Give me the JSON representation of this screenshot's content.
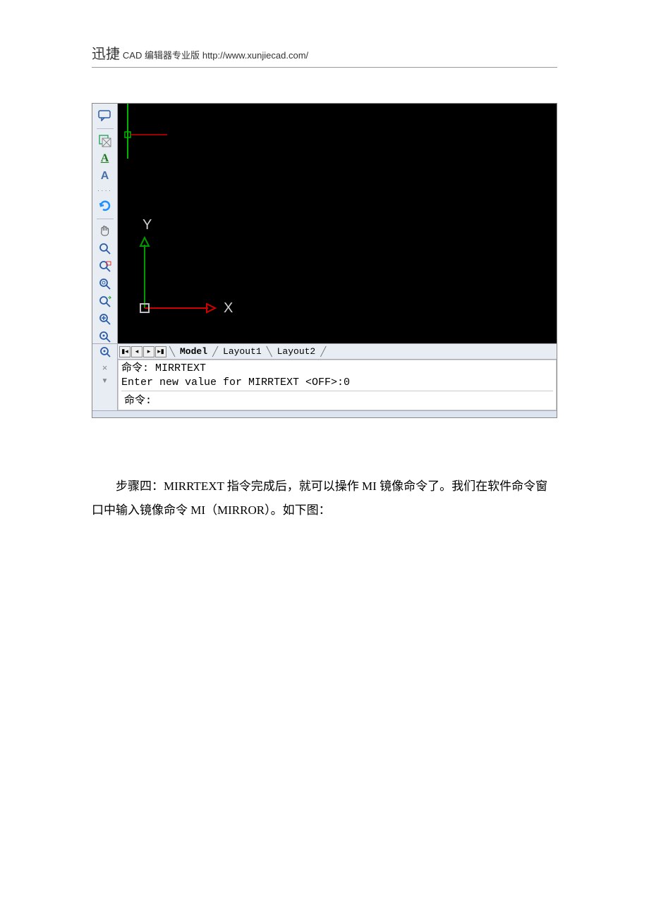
{
  "header": {
    "brand": "迅捷",
    "product": "CAD 编辑器专业版",
    "url": "http://www.xunjiecad.com/"
  },
  "toolbar": {
    "icons": [
      {
        "name": "word-balloon-icon",
        "glyph": "💬"
      },
      {
        "name": "overlap-rect-icon",
        "glyph": "▧"
      },
      {
        "name": "text-underline-a-icon",
        "glyph": "A",
        "underline": true,
        "color": "#1e7a1e"
      },
      {
        "name": "text-a-icon",
        "glyph": "A",
        "color": "#2a5ca8"
      }
    ],
    "icons2": [
      {
        "name": "refresh-icon",
        "glyph": "↺",
        "color": "#1e90ff"
      },
      {
        "name": "pan-hand-icon",
        "glyph": "✋"
      },
      {
        "name": "zoom-lens-icon",
        "glyph": "🔍"
      },
      {
        "name": "zoom-window-icon",
        "glyph": "🔍"
      },
      {
        "name": "zoom-realtime-icon",
        "glyph": "🔍"
      },
      {
        "name": "zoom-previous-icon",
        "glyph": "🔍"
      },
      {
        "name": "zoom-in-icon",
        "glyph": "🔍"
      },
      {
        "name": "zoom-extents-icon",
        "glyph": "🔍"
      }
    ]
  },
  "canvas": {
    "y_label": "Y",
    "x_label": "X"
  },
  "tabs": {
    "model": "Model",
    "layout1": "Layout1",
    "layout2": "Layout2"
  },
  "command": {
    "line1": "命令: MIRRTEXT",
    "line2": "Enter new value for MIRRTEXT <OFF>:0",
    "prompt": "命令:"
  },
  "paragraph": "步骤四：MIRRTEXT 指令完成后，就可以操作 MI 镜像命令了。我们在软件命令窗口中输入镜像命令 MI（MIRROR）。如下图："
}
